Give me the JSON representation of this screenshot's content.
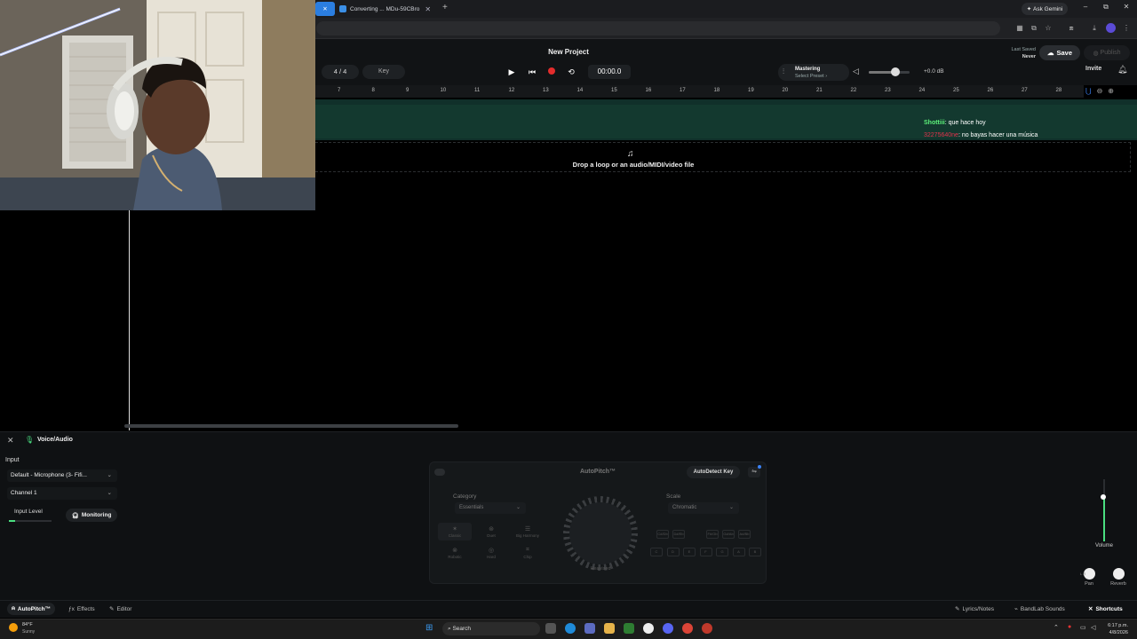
{
  "browser": {
    "tabs": [
      {
        "label": "",
        "active": true
      },
      {
        "label": "Converting ... MDu-59CBro",
        "active": false
      }
    ],
    "new_tab": "+",
    "gemini": "Ask Gemini",
    "window_controls": {
      "minimize": "–",
      "restore": "⧉",
      "close": "✕"
    }
  },
  "header": {
    "project_title": "New Project",
    "time_signature": "4 / 4",
    "key_label": "Key",
    "time": "00:00.0",
    "mastering": {
      "title": "Mastering",
      "subtitle": "Select Preset ›"
    },
    "master_volume": {
      "level": 0.65,
      "db": "+0.0 dB"
    },
    "last_saved_label": "Last Saved",
    "last_saved_value": "Never",
    "save": "Save",
    "publish": "Publish",
    "invite": "Invite"
  },
  "ruler": {
    "ticks": [
      "7",
      "8",
      "9",
      "10",
      "11",
      "12",
      "13",
      "14",
      "15",
      "16",
      "17",
      "18",
      "19",
      "20",
      "21",
      "22",
      "23",
      "24",
      "25",
      "26",
      "27",
      "28"
    ]
  },
  "dropzone": {
    "text": "Drop a loop or an audio/MIDI/video file"
  },
  "chat": [
    {
      "user": "Shottiii",
      "message": ": que hace hoy"
    },
    {
      "user": "32275640ne",
      "message": ": no bayas hacer una música"
    }
  ],
  "panel": {
    "title": "Voice/Audio",
    "input_label": "Input",
    "device": "Default - Microphone (3- Fifi...",
    "channel": "Channel 1",
    "input_level_label": "Input Level",
    "input_level": 0.15,
    "monitoring": "Monitoring"
  },
  "autopitch": {
    "title": "AutoPitch™",
    "autodetect": "AutoDetect Key",
    "category_label": "Category",
    "category_value": "Essentials",
    "scale_label": "Scale",
    "scale_value": "Chromatic",
    "categories": [
      {
        "label": "Classic",
        "icon": "✶"
      },
      {
        "label": "Duet",
        "icon": "⊛"
      },
      {
        "label": "Big Harmony",
        "icon": "☰"
      },
      {
        "label": "Robotic",
        "icon": "⊗"
      },
      {
        "label": "Hard",
        "icon": "◎"
      },
      {
        "label": "Chip",
        "icon": "⌗"
      }
    ],
    "knob_label": "Heavised",
    "sharp_keys": [
      "C#/Db",
      "D#/Eb",
      "F#/Gb",
      "G#/Ab",
      "A#/Bb"
    ],
    "natural_keys": [
      "C",
      "D",
      "E",
      "F",
      "G",
      "A",
      "B"
    ]
  },
  "mixer": {
    "volume_label": "Volume",
    "volume_level": 0.72,
    "pan_label": "Pan",
    "reverb_label": "Reverb",
    "pan_letters": "L R"
  },
  "bottom_tabs": {
    "autopitch": "AutoPitch™",
    "effects": "Effects",
    "editor": "Editor",
    "lyrics": "Lyrics/Notes",
    "sounds": "BandLab Sounds",
    "shortcuts": "Shortcuts"
  },
  "taskbar": {
    "weather_temp": "84°F",
    "weather_desc": "Sunny",
    "search": "Search",
    "time": "6:17 p.m.",
    "date": "4/8/2026"
  },
  "colors": {
    "accent": "#4ade80",
    "record": "#e32c2c",
    "track": "#13392f",
    "brand_blue": "#3b82f6"
  }
}
